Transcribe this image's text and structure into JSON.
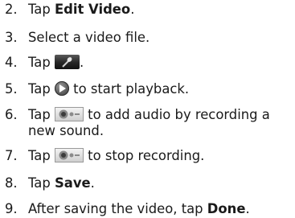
{
  "steps": [
    {
      "num": "2.",
      "pre": "Tap ",
      "bold": "Edit Video",
      "post": "."
    },
    {
      "num": "3.",
      "text": "Select a video file."
    },
    {
      "num": "4.",
      "pre": "Tap ",
      "post": ".",
      "icon": "microphone-icon"
    },
    {
      "num": "5.",
      "pre": "Tap ",
      "post": " to start playback.",
      "icon": "play-icon"
    },
    {
      "num": "6.",
      "pre": "Tap ",
      "post": " to add audio by recording a",
      "line2": "new sound.",
      "icon": "record-icon"
    },
    {
      "num": "7.",
      "pre": "Tap ",
      "post": " to stop recording.",
      "icon": "record-icon"
    },
    {
      "num": "8.",
      "pre": "Tap ",
      "bold": "Save",
      "post": "."
    },
    {
      "num": "9.",
      "pre": "After saving the video, tap ",
      "bold": "Done",
      "post": "."
    }
  ]
}
